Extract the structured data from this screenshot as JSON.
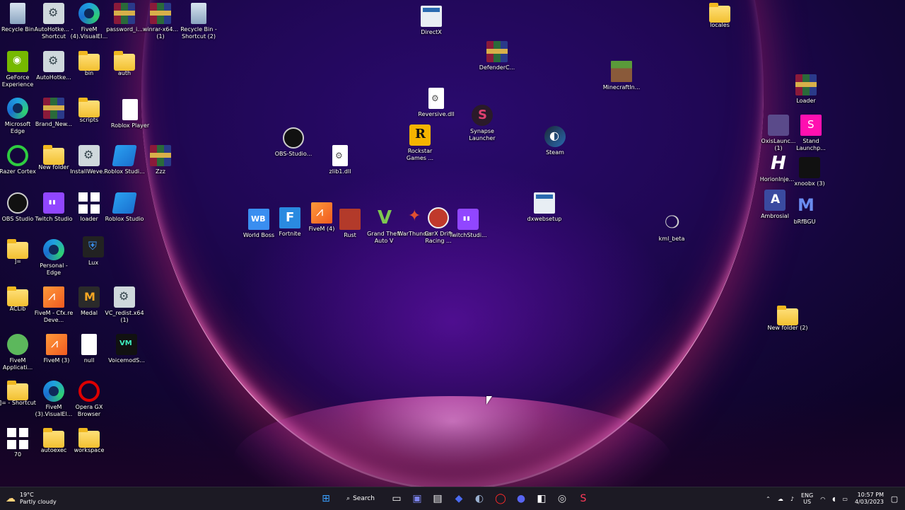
{
  "desktop_icons": [
    {
      "label": "Recycle Bin",
      "icon": "recycle-bin-icon",
      "g": "g-recycle",
      "x": 0,
      "y": 0
    },
    {
      "label": "AutoHotke... - Shortcut",
      "icon": "file-icon",
      "g": "g-gear",
      "x": 0,
      "y": 0
    },
    {
      "label": "FiveM (4).VisualEl...",
      "icon": "edge-icon",
      "g": "g-edge",
      "x": 0,
      "y": 0
    },
    {
      "label": "password_i...",
      "icon": "winrar-icon",
      "g": "g-rar",
      "x": 0,
      "y": 0
    },
    {
      "label": "winrar-x64... (1)",
      "icon": "winrar-icon",
      "g": "g-rar",
      "x": 0,
      "y": 0
    },
    {
      "label": "Recycle Bin - Shortcut (2)",
      "icon": "recycle-bin-icon",
      "g": "g-recycle",
      "x": 0,
      "y": 0
    },
    {
      "label": "GeForce Experience",
      "icon": "nvidia-icon",
      "g": "g-nvidia",
      "x": 0,
      "y": 0
    },
    {
      "label": "AutoHotke...",
      "icon": "file-icon",
      "g": "g-gear",
      "x": 0,
      "y": 0
    },
    {
      "label": "bin",
      "icon": "folder-icon",
      "g": "g-folder",
      "x": 0,
      "y": 0
    },
    {
      "label": "auth",
      "icon": "folder-icon",
      "g": "g-folder",
      "x": 0,
      "y": 0
    },
    {
      "label": "Microsoft Edge",
      "icon": "edge-icon",
      "g": "g-edge",
      "x": 0,
      "y": 0
    },
    {
      "label": "Brand_New...",
      "icon": "winrar-icon",
      "g": "g-rar",
      "x": 0,
      "y": 0
    },
    {
      "label": "scripts",
      "icon": "folder-icon",
      "g": "g-folder",
      "x": 0,
      "y": 0
    },
    {
      "label": "Roblox Player",
      "icon": "roblox-icon",
      "g": "g-null",
      "x": 0,
      "y": 0
    },
    {
      "label": "Razer Cortex",
      "icon": "razer-icon",
      "g": "g-green-ring",
      "x": 0,
      "y": 0
    },
    {
      "label": "New folder",
      "icon": "folder-icon",
      "g": "g-folder",
      "x": 0,
      "y": 0
    },
    {
      "label": "InstallWeve...",
      "icon": "installer-icon",
      "g": "g-gear",
      "x": 0,
      "y": 0
    },
    {
      "label": "Roblox Studi...",
      "icon": "roblox-studio-icon",
      "g": "g-roblox",
      "x": 0,
      "y": 0
    },
    {
      "label": "Zzz",
      "icon": "winrar-icon",
      "g": "g-rar",
      "x": 0,
      "y": 0
    },
    {
      "label": "OBS Studio",
      "icon": "obs-icon",
      "g": "g-obs",
      "x": 0,
      "y": 0
    },
    {
      "label": "Twitch Studio",
      "icon": "twitch-icon",
      "g": "g-twitch",
      "x": 0,
      "y": 0
    },
    {
      "label": "loader",
      "icon": "window-icon",
      "g": "g-win",
      "x": 0,
      "y": 0
    },
    {
      "label": "Roblox Studio",
      "icon": "roblox-studio-icon",
      "g": "g-roblox",
      "x": 0,
      "y": 0
    },
    {
      "label": "]=",
      "icon": "folder-icon",
      "g": "g-folder",
      "x": 0,
      "y": 0
    },
    {
      "label": "Personal - Edge",
      "icon": "edge-icon",
      "g": "g-edge",
      "x": 0,
      "y": 0
    },
    {
      "label": "Lux",
      "icon": "shield-icon",
      "g": "g-lux",
      "x": 0,
      "y": 0
    },
    {
      "label": "ACLib",
      "icon": "folder-icon",
      "g": "g-folder",
      "x": 0,
      "y": 0
    },
    {
      "label": "FiveM - Cfx.re Deve...",
      "icon": "fivem-icon",
      "g": "g-fivem",
      "x": 0,
      "y": 0
    },
    {
      "label": "Medal",
      "icon": "medal-icon",
      "g": "g-medal",
      "x": 0,
      "y": 0
    },
    {
      "label": "VC_redist.x64 (1)",
      "icon": "installer-icon",
      "g": "g-gear",
      "x": 0,
      "y": 0
    },
    {
      "label": "FiveM Applicati...",
      "icon": "snail-icon",
      "g": "g-snail",
      "x": 0,
      "y": 0
    },
    {
      "label": "FiveM (3)",
      "icon": "fivem-icon",
      "g": "g-fivem",
      "x": 0,
      "y": 0
    },
    {
      "label": "null",
      "icon": "file-icon",
      "g": "g-null",
      "x": 0,
      "y": 0
    },
    {
      "label": "VoicemodS...",
      "icon": "voicemod-icon",
      "g": "g-voicemod",
      "x": 0,
      "y": 0
    },
    {
      "label": "]= - Shortcut",
      "icon": "folder-icon",
      "g": "g-folder",
      "x": 0,
      "y": 0
    },
    {
      "label": "FiveM (3).VisualEl...",
      "icon": "edge-icon",
      "g": "g-edge",
      "x": 0,
      "y": 0
    },
    {
      "label": "Opera GX Browser",
      "icon": "opera-icon",
      "g": "g-opera",
      "x": 0,
      "y": 0
    },
    {
      "label": "70",
      "icon": "window-icon",
      "g": "g-win",
      "x": 0,
      "y": 0
    },
    {
      "label": "autoexec",
      "icon": "folder-icon",
      "g": "g-folder",
      "x": 0,
      "y": 0
    },
    {
      "label": "workspace",
      "icon": "folder-icon",
      "g": "g-folder",
      "x": 0,
      "y": 0
    },
    {
      "label": "DirectX",
      "icon": "installer-icon",
      "g": "g-dxweb",
      "x": 0,
      "y": 0
    },
    {
      "label": "DefenderC...",
      "icon": "winrar-icon",
      "g": "g-rar",
      "x": 0,
      "y": 0
    },
    {
      "label": "Reversive.dll",
      "icon": "dll-file-icon",
      "g": "g-file",
      "x": 0,
      "y": 0
    },
    {
      "label": "Synapse Launcher",
      "icon": "synapse-icon",
      "g": "g-synapse",
      "x": 0,
      "y": 0
    },
    {
      "label": "Rockstar Games ...",
      "icon": "rockstar-icon",
      "g": "g-rockstar",
      "x": 0,
      "y": 0
    },
    {
      "label": "Steam",
      "icon": "steam-icon",
      "g": "g-steam",
      "x": 0,
      "y": 0
    },
    {
      "label": "OBS-Studio...",
      "icon": "obs-icon",
      "g": "g-obs",
      "x": 0,
      "y": 0
    },
    {
      "label": "zlib1.dll",
      "icon": "dll-file-icon",
      "g": "g-file",
      "x": 0,
      "y": 0
    },
    {
      "label": "World Boss",
      "icon": "world-boss-icon",
      "g": "g-worldboss",
      "x": 0,
      "y": 0
    },
    {
      "label": "Fortnite",
      "icon": "fortnite-icon",
      "g": "g-fortnite",
      "x": 0,
      "y": 0
    },
    {
      "label": "FiveM (4)",
      "icon": "fivem-icon",
      "g": "g-fivem",
      "x": 0,
      "y": 0
    },
    {
      "label": "Rust",
      "icon": "rust-icon",
      "g": "g-rust",
      "x": 0,
      "y": 0
    },
    {
      "label": "Grand Theft Auto V",
      "icon": "gta-icon",
      "g": "g-gta",
      "x": 0,
      "y": 0
    },
    {
      "label": "WarThunder",
      "icon": "warthunder-icon",
      "g": "g-warthunder",
      "x": 0,
      "y": 0
    },
    {
      "label": "CarX Drift Racing ...",
      "icon": "carx-icon",
      "g": "g-carx",
      "x": 0,
      "y": 0
    },
    {
      "label": "TwitchStudi...",
      "icon": "twitch-icon",
      "g": "g-twitch",
      "x": 0,
      "y": 0
    },
    {
      "label": "dxwebsetup",
      "icon": "installer-icon",
      "g": "g-dxweb",
      "x": 0,
      "y": 0
    },
    {
      "label": "kml_beta",
      "icon": "leaf-icon",
      "g": "g-leaf",
      "x": 0,
      "y": 0
    },
    {
      "label": "MinecraftIn...",
      "icon": "minecraft-icon",
      "g": "g-minecraft",
      "x": 0,
      "y": 0
    },
    {
      "label": "locales",
      "icon": "folder-icon",
      "g": "g-folder",
      "x": 0,
      "y": 0
    },
    {
      "label": "Loader",
      "icon": "winrar-icon",
      "g": "g-rar",
      "x": 0,
      "y": 0
    },
    {
      "label": "OxisLaunc... (1)",
      "icon": "oxys-icon",
      "g": "g-oxys",
      "x": 0,
      "y": 0
    },
    {
      "label": "Stand Launchp...",
      "icon": "stand-icon",
      "g": "g-pink",
      "x": 0,
      "y": 0
    },
    {
      "label": "HorionInje...",
      "icon": "horion-icon",
      "g": "g-horizon",
      "x": 0,
      "y": 0
    },
    {
      "label": "xnoobx (3)",
      "icon": "xnoobx-icon",
      "g": "g-xnoobx",
      "x": 0,
      "y": 0
    },
    {
      "label": "Ambrosial",
      "icon": "ambrosial-icon",
      "g": "g-ambrosial",
      "x": 0,
      "y": 0
    },
    {
      "label": "bRfBGU",
      "icon": "brfbgu-icon",
      "g": "g-brfbgu",
      "x": 0,
      "y": 0
    },
    {
      "label": "New folder (2)",
      "icon": "folder-icon",
      "g": "g-folder",
      "x": 0,
      "y": 0
    }
  ],
  "taskbar": {
    "weather": {
      "temp": "19°C",
      "condition": "Partly cloudy",
      "icon": "cloud-sun-icon"
    },
    "search_label": "Search",
    "apps": [
      {
        "name": "start",
        "icon": "windows-start-icon",
        "glyph": "⊞",
        "color": "#3aa0ff"
      },
      {
        "name": "task-view",
        "icon": "task-view-icon",
        "glyph": "▭",
        "color": "#ffffff"
      },
      {
        "name": "chat",
        "icon": "chat-icon",
        "glyph": "▣",
        "color": "#7b83eb"
      },
      {
        "name": "store",
        "icon": "store-icon",
        "glyph": "▤",
        "color": "#ffffff"
      },
      {
        "name": "app",
        "icon": "app-icon",
        "glyph": "◆",
        "color": "#4a6af0"
      },
      {
        "name": "steam",
        "icon": "steam-icon",
        "glyph": "◐",
        "color": "#9ab0d0"
      },
      {
        "name": "opera",
        "icon": "opera-icon",
        "glyph": "◯",
        "color": "#ff2a2a"
      },
      {
        "name": "discord",
        "icon": "discord-icon",
        "glyph": "●",
        "color": "#5865f2"
      },
      {
        "name": "app2",
        "icon": "app-icon",
        "glyph": "◧",
        "color": "#ffffff"
      },
      {
        "name": "app3",
        "icon": "app-icon",
        "glyph": "◎",
        "color": "#dddddd"
      },
      {
        "name": "app4",
        "icon": "app-icon",
        "glyph": "S",
        "color": "#ff3a5a"
      }
    ],
    "tray": {
      "lang": "ENG",
      "region": "US",
      "time": "10:57 PM",
      "date": "4/03/2023"
    }
  }
}
